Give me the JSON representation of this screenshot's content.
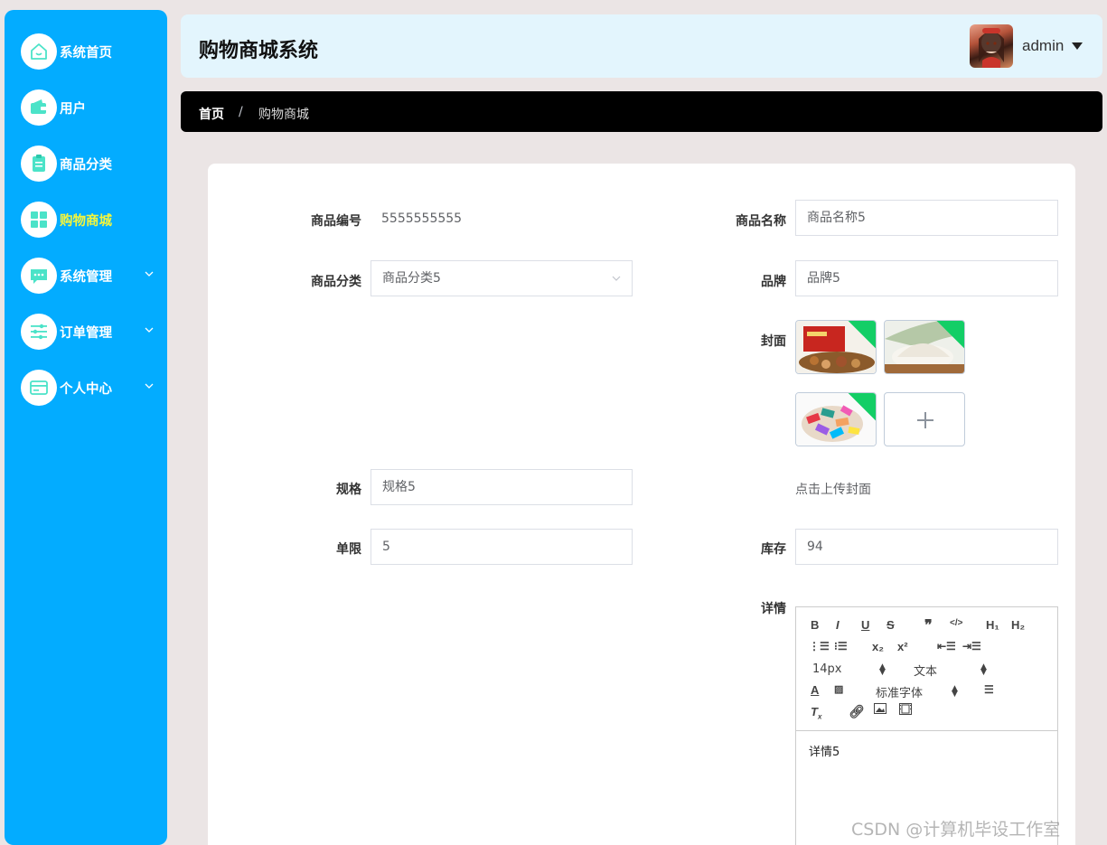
{
  "sidebar": {
    "items": [
      {
        "label": "系统首页",
        "icon": "home-icon"
      },
      {
        "label": "用户",
        "icon": "wallet-icon"
      },
      {
        "label": "商品分类",
        "icon": "clipboard-icon"
      },
      {
        "label": "购物商城",
        "icon": "grid-icon",
        "active": true
      },
      {
        "label": "系统管理",
        "icon": "chat-icon",
        "expandable": true
      },
      {
        "label": "订单管理",
        "icon": "sliders-icon",
        "expandable": true
      },
      {
        "label": "个人中心",
        "icon": "card-icon",
        "expandable": true
      }
    ],
    "accent_color": "#03acff",
    "active_color": "#f4f63d"
  },
  "header": {
    "title": "购物商城系统",
    "user_name": "admin"
  },
  "breadcrumb": {
    "home": "首页",
    "separator": "/",
    "current": "购物商城"
  },
  "form": {
    "product_code": {
      "label": "商品编号",
      "value": "5555555555"
    },
    "product_name": {
      "label": "商品名称",
      "value": "商品名称5"
    },
    "category": {
      "label": "商品分类",
      "value": "商品分类5"
    },
    "brand": {
      "label": "品牌",
      "value": "品牌5"
    },
    "cover": {
      "label": "封面",
      "hint": "点击上传封面",
      "images": [
        "nuts-gift-box",
        "white-powder",
        "candy-pile"
      ]
    },
    "spec": {
      "label": "规格",
      "value": "规格5"
    },
    "limit": {
      "label": "单限",
      "value": "5"
    },
    "stock": {
      "label": "库存",
      "value": "94"
    },
    "detail": {
      "label": "详情",
      "toolbar": {
        "font_size": "14px",
        "header_type": "文本",
        "font_family": "标准字体"
      },
      "content": "详情5"
    }
  },
  "watermark": "CSDN @计算机毕设工作室"
}
